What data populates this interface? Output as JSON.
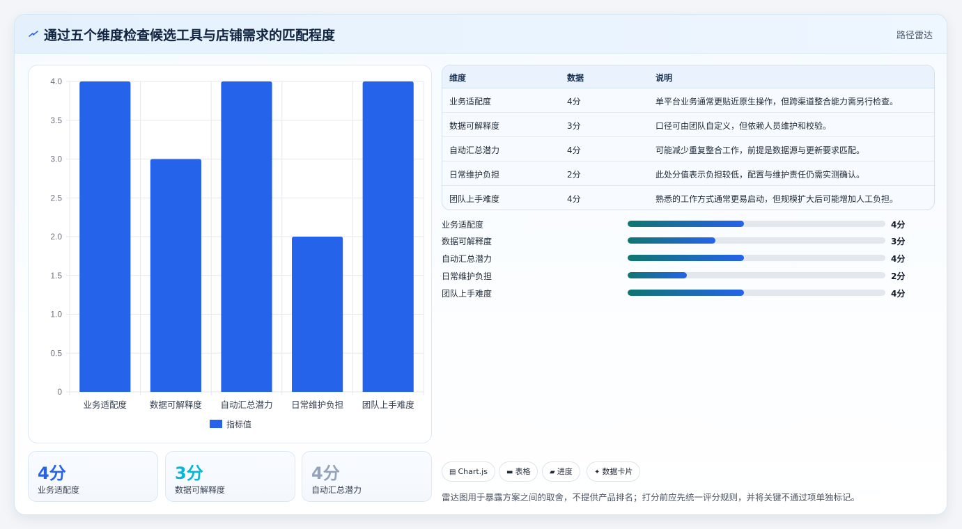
{
  "header": {
    "icon": "lightning-icon",
    "title": "通过五个维度检查候选工具与店铺需求的匹配程度",
    "tag": "路径雷达"
  },
  "chart_data": {
    "type": "bar",
    "categories": [
      "业务适配度",
      "数据可解释度",
      "自动汇总潜力",
      "日常维护负担",
      "团队上手难度"
    ],
    "series": [
      {
        "name": "指标值",
        "values": [
          4,
          3,
          4,
          2,
          4
        ],
        "color": "#2563eb"
      }
    ],
    "y_ticks": [
      "0",
      "0.5",
      "1.0",
      "1.5",
      "2.0",
      "2.5",
      "3.0",
      "3.5",
      "4.0"
    ],
    "ylim": [
      0,
      4
    ],
    "grid": true,
    "legend": "bottom"
  },
  "kpis": [
    {
      "value": "4分",
      "label": "业务适配度",
      "color": "#2563eb"
    },
    {
      "value": "3分",
      "label": "数据可解释度",
      "color": "#06b6d4"
    },
    {
      "value": "4分",
      "label": "自动汇总潜力",
      "color": "#94a3b8"
    }
  ],
  "table": {
    "headers": [
      "维度",
      "数据",
      "说明"
    ],
    "rows": [
      [
        "业务适配度",
        "4分",
        "单平台业务通常更贴近原生操作，但跨渠道整合能力需另行检查。"
      ],
      [
        "数据可解释度",
        "3分",
        "口径可由团队自定义，但依赖人员维护和校验。"
      ],
      [
        "自动汇总潜力",
        "4分",
        "可能减少重复整合工作，前提是数据源与更新要求匹配。"
      ],
      [
        "日常维护负担",
        "2分",
        "此处分值表示负担较低，配置与维护责任仍需实测确认。"
      ],
      [
        "团队上手难度",
        "4分",
        "熟悉的工作方式通常更易启动，但规模扩大后可能增加人工负担。"
      ]
    ]
  },
  "progress": [
    {
      "label": "业务适配度",
      "value": "4分",
      "fraction": 0.45
    },
    {
      "label": "数据可解释度",
      "value": "3分",
      "fraction": 0.34
    },
    {
      "label": "自动汇总潜力",
      "value": "4分",
      "fraction": 0.45
    },
    {
      "label": "日常维护负担",
      "value": "2分",
      "fraction": 0.23
    },
    {
      "label": "团队上手难度",
      "value": "4分",
      "fraction": 0.45
    }
  ],
  "chips": [
    {
      "icon": "chart-icon",
      "glyph": "▤",
      "label": "Chart.js"
    },
    {
      "icon": "table-icon",
      "glyph": "▬",
      "label": "表格"
    },
    {
      "icon": "progress-icon",
      "glyph": "▰",
      "label": "进度"
    },
    {
      "icon": "sparkle-icon",
      "glyph": "✦",
      "label": "数据卡片"
    }
  ],
  "footnote": "雷达图用于暴露方案之间的取舍，不提供产品排名；打分前应先统一评分规则，并将关键不通过项单独标记。"
}
